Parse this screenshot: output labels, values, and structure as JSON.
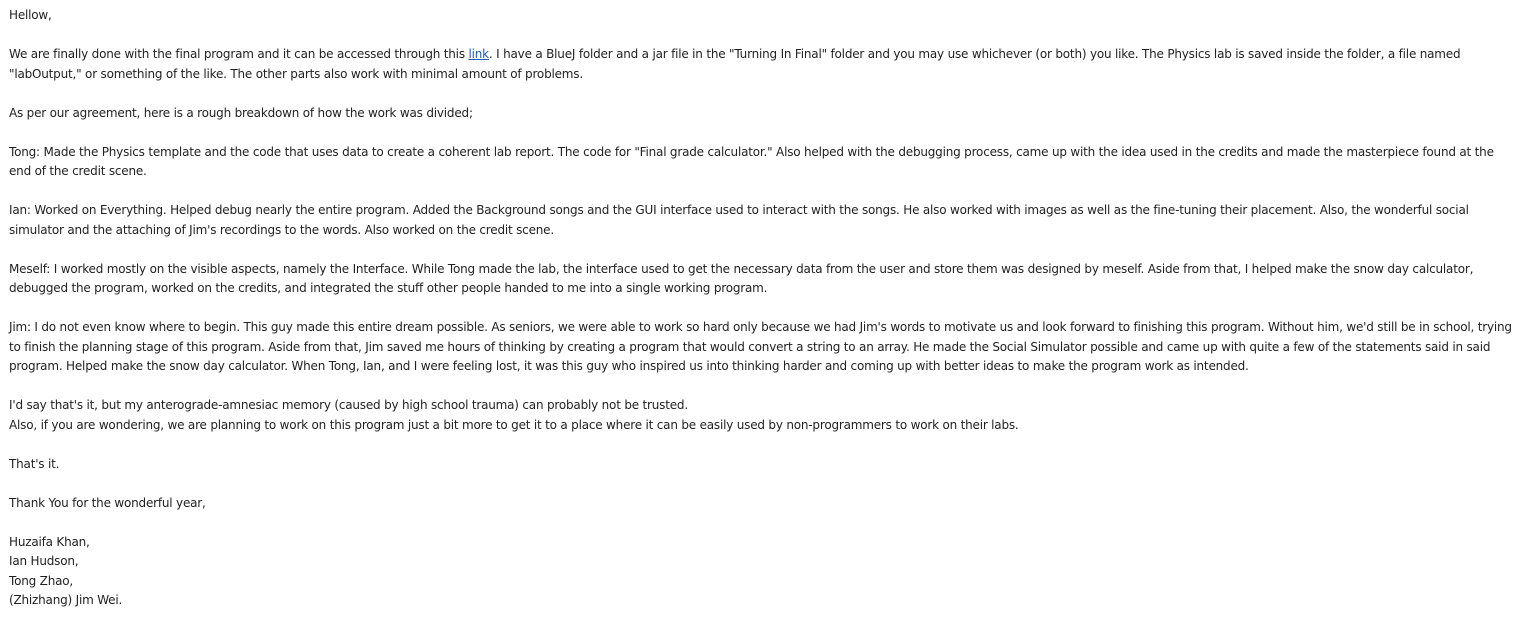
{
  "email": {
    "greeting": "Hellow,",
    "intro_before_link": "We are finally done with the final program and it can be accessed through this ",
    "link_text": "link",
    "intro_after_link": ". I have a BlueJ folder and a jar file in the \"Turning In Final\" folder and you may use whichever (or both) you like. The Physics lab is saved inside the folder, a file named \"labOutput,\" or something of the like. The other parts also work with minimal amount of problems.",
    "agreement": "As per our agreement, here is a rough breakdown of how the work was divided;",
    "tong": "Tong: Made the Physics template and the code that uses data to create a coherent lab report. The code for \"Final grade calculator.\" Also helped with the debugging process, came up with the idea used in the credits and made the masterpiece found at the end of the credit scene.",
    "ian": "Ian: Worked on Everything. Helped debug nearly the entire program. Added the Background songs and the GUI interface used to interact with the songs. He also worked with images as well as the fine-tuning their placement. Also, the wonderful social simulator and the attaching of Jim's recordings to the words. Also worked on the credit scene.",
    "meself": "Meself: I worked mostly on the visible aspects, namely the Interface. While Tong made the lab, the interface used to get the necessary data from the user and store them was designed by meself. Aside from that, I helped make the snow day calculator, debugged the program, worked on the credits, and integrated the stuff other people handed to me into a single working program.",
    "jim": "Jim: I do not even know where to begin. This guy made this entire dream possible. As seniors, we were able to work so hard only because we had Jim's words to motivate us and look forward to finishing this program. Without him, we'd still be in school, trying to finish the planning stage of this program. Aside from that, Jim saved me hours of thinking by creating a program that would convert a string to an array. He made the Social Simulator possible and came up with quite a few of the statements said in said program. Helped make the snow day calculator. When Tong, Ian, and I were feeling lost, it was this guy who inspired us into thinking harder and coming up with better ideas to make the program work as intended.",
    "memory_line": "I'd say that's it, but my anterograde-amnesiac memory (caused by high school trauma) can probably not be trusted.",
    "wondering_line": "Also, if you are wondering, we are planning to work on this program just a bit more to get it to a place where it can be easily used by non-programmers to work on their labs.",
    "thats_it": "That's it.",
    "thanks": "Thank You for the wonderful year,",
    "signatures": [
      "Huzaifa Khan,",
      "Ian Hudson,",
      "Tong Zhao,",
      "(Zhizhang) Jim Wei."
    ]
  }
}
